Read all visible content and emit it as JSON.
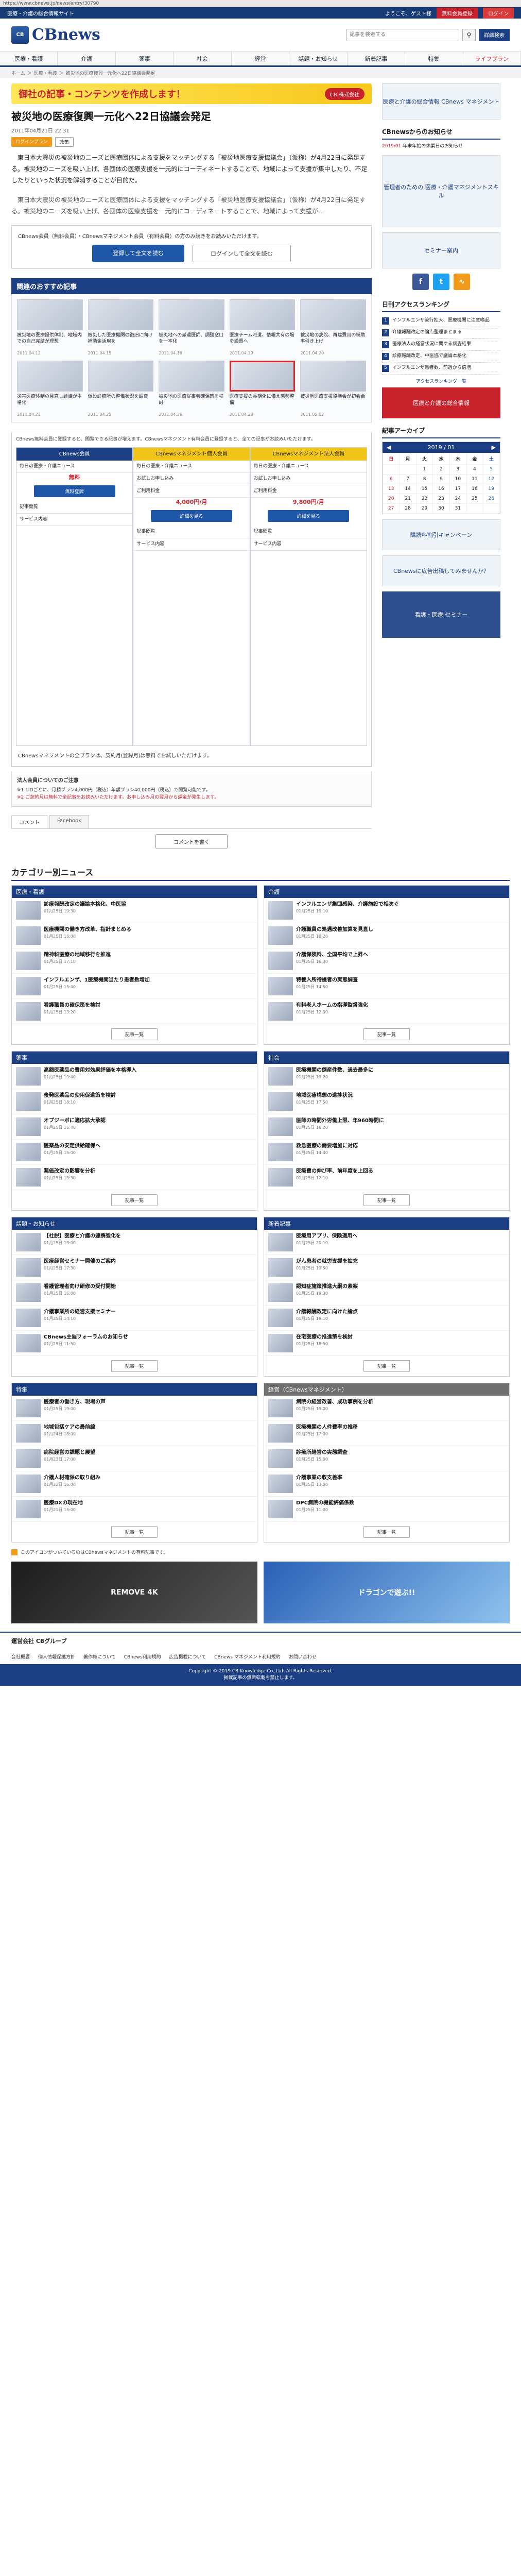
{
  "browser": {
    "url": "https://www.cbnews.jp/news/entry/30790"
  },
  "topstrip": {
    "left": [
      "医療・介護の総合情報サイト"
    ],
    "welcome": "ようこそ、ゲスト様",
    "register": "無料会員登録",
    "login": "ログイン"
  },
  "header": {
    "logo_mark": "CB",
    "logo": "CBnews",
    "search_placeholder": "記事を検索する",
    "advanced": "詳細検索"
  },
  "nav": [
    "医療・看護",
    "介護",
    "薬事",
    "社会",
    "経営",
    "話題・お知らせ",
    "新着記事",
    "特集",
    "ライフプラン"
  ],
  "breadcrumb": [
    "ホーム",
    "＞",
    "医療・看護",
    "＞",
    "被災地の医療復興一元化へ22日協議会発足"
  ],
  "banner": {
    "title": "御社の記事・コンテンツを作成します！",
    "sub": "CB 株式会社"
  },
  "article": {
    "title": "被災地の医療復興一元化へ22日協議会発足",
    "date": "2011年04月21日 22:31",
    "tags": [
      "ログインプラン",
      "政策"
    ],
    "p1": "東日本大震災の被災地のニーズと医療団体による支援をマッチングする「被災地医療支援協議会」（仮称）が4月22日に発足する。被災地のニーズを吸い上げ、各団体の医療支援を一元的にコーディネートすることで、地域によって支援が集中したり、不足したりといった状況を解消することが目的だ。",
    "p2": "東日本大震災の被災地のニーズと医療団体による支援をマッチングする「被災地医療支援協議会」（仮称）が4月22日に発足する。被災地のニーズを吸い上げ、各団体の医療支援を一元的にコーディネートすることで、地域によって支援が..."
  },
  "loginbox": {
    "msg": "CBnews会員（無料会員）・CBnewsマネジメント会員（有料会員）の方のみ続きをお読みいただけます。",
    "register": "登録して全文を読む",
    "login": "ログインして全文を読む"
  },
  "recommend": {
    "heading": "関連のおすすめ記事",
    "items": [
      {
        "t": "被災地の医療提供体制、地域内での自己完結が理想",
        "d": "2011.04.12"
      },
      {
        "t": "被災した医療機関の復旧に向け補助金活用を",
        "d": "2011.04.15"
      },
      {
        "t": "被災地への派遣医師、調整窓口を一本化",
        "d": "2011.04.18"
      },
      {
        "t": "医療チーム派遣、情報共有の場を設置へ",
        "d": "2011.04.19"
      },
      {
        "t": "被災地の病院、再建費用の補助率引き上げ",
        "d": "2011.04.20"
      },
      {
        "t": "災害医療体制の見直し論議が本格化",
        "d": "2011.04.22"
      },
      {
        "t": "仮設診療所の整備状況を調査",
        "d": "2011.04.25"
      },
      {
        "t": "被災地の医療従事者確保策を検討",
        "d": "2011.04.26"
      },
      {
        "t": "医療支援の長期化に備え態勢整備",
        "d": "2011.04.28"
      },
      {
        "t": "被災地医療支援協議会が初会合",
        "d": "2011.05.02"
      }
    ]
  },
  "plans": {
    "note": "CBnews無料会員に登録すると、閲覧できる記事が増えます。CBnewsマネジメント有料会員に登録すると、全ての記事がお読みいただけます。",
    "cols": [
      {
        "name": "CBnews会員",
        "price": "無料",
        "cta": "無料登録"
      },
      {
        "name": "CBnewsマネジメント個人会員",
        "price": "4,000円/月",
        "cta": "詳細を見る"
      },
      {
        "name": "CBnewsマネジメント法人会員",
        "price": "9,800円/月",
        "cta": "詳細を見る"
      }
    ],
    "rows": [
      "毎日の医療・介護ニュース",
      "お試しお申し込み",
      "ご利用料金",
      "記事閲覧",
      "サービス内容"
    ],
    "foot": "CBnewsマネジメントの全プランは、契約月(登録月)は無料でお試しいただけます。"
  },
  "pay": {
    "head": "法人会員についてのご注意",
    "l1": "※1 1IDごとに、月額プラン4,000円（税込）年額プラン40,000円（税込）で閲覧可能です。",
    "l2": "※2 ご契約月は無料で全記事をお読みいただけます。お申し込み月の翌月から課金が発生します。"
  },
  "comments": {
    "tab1": "コメント",
    "tab2": "Facebook",
    "btn": "コメントを書く"
  },
  "side": {
    "ad1": "医療と介護の総合情報 CBnews マネジメント",
    "news_h": "CBnewsからのお知らせ",
    "news": [
      {
        "d": "2019/01",
        "t": "年末年始の休業日のお知らせ"
      }
    ],
    "ad2": "管理者のための 医療・介護マネジメントスキル",
    "ad3": "セミナー案内",
    "rank_h": "日刊アクセスランキング",
    "rank": [
      "インフルエンザ流行拡大、医療機関に注意喚起",
      "介護報酬改定の論点整理まとまる",
      "医療法人の経営状況に関する調査結果",
      "診療報酬改定、中医協で議論本格化",
      "インフルエンザ患者数、前週から倍増"
    ],
    "more": "アクセスランキング一覧",
    "ad4": "医療と介護の総合情報",
    "archive_h": "記事アーカイブ",
    "cal_title": "2019 / 01",
    "cal_days": [
      "日",
      "月",
      "火",
      "水",
      "木",
      "金",
      "土"
    ],
    "ad5": "購読料割引キャンペーン",
    "ad6": "CBnewsに広告出稿してみませんか？",
    "ad7": "看護・医療 セミナー"
  },
  "categories": {
    "heading": "カテゴリー別ニュース",
    "boxes": [
      {
        "name": "医療・看護",
        "items": [
          {
            "t": "診療報酬改定の議論本格化、中医協",
            "d": "01月25日 19:30"
          },
          {
            "t": "医療機関の働き方改革、指針まとめる",
            "d": "01月25日 18:00"
          },
          {
            "t": "精神科医療の地域移行を推進",
            "d": "01月25日 17:10"
          },
          {
            "t": "インフルエンザ、1医療機関当たり患者数増加",
            "d": "01月25日 15:40"
          },
          {
            "t": "看護職員の確保策を検討",
            "d": "01月25日 13:20"
          }
        ]
      },
      {
        "name": "介護",
        "items": [
          {
            "t": "インフルエンザ集団感染、介護施設で相次ぐ",
            "d": "01月25日 19:10"
          },
          {
            "t": "介護職員の処遇改善加算を見直し",
            "d": "01月25日 18:20"
          },
          {
            "t": "介護保険料、全国平均で上昇へ",
            "d": "01月25日 16:30"
          },
          {
            "t": "特養入所待機者の実態調査",
            "d": "01月25日 14:50"
          },
          {
            "t": "有料老人ホームの指導監督強化",
            "d": "01月25日 12:00"
          }
        ]
      },
      {
        "name": "薬事",
        "items": [
          {
            "t": "高額医薬品の費用対効果評価を本格導入",
            "d": "01月25日 19:40"
          },
          {
            "t": "後発医薬品の使用促進策を検討",
            "d": "01月25日 18:10"
          },
          {
            "t": "オプジーボに適応拡大承認",
            "d": "01月25日 16:40"
          },
          {
            "t": "医薬品の安定供給確保へ",
            "d": "01月25日 15:00"
          },
          {
            "t": "薬価改定の影響を分析",
            "d": "01月25日 13:30"
          }
        ]
      },
      {
        "name": "社会",
        "items": [
          {
            "t": "医療機関の倒産件数、過去最多に",
            "d": "01月25日 19:20"
          },
          {
            "t": "地域医療構想の進捗状況",
            "d": "01月25日 17:50"
          },
          {
            "t": "医師の時間外労働上限、年960時間に",
            "d": "01月25日 16:20"
          },
          {
            "t": "救急医療の需要増加に対応",
            "d": "01月25日 14:40"
          },
          {
            "t": "医療費の伸び率、前年度を上回る",
            "d": "01月25日 12:10"
          }
        ]
      },
      {
        "name": "話題・お知らせ",
        "items": [
          {
            "t": "【社説】医療と介護の連携強化を",
            "d": "01月25日 19:00"
          },
          {
            "t": "医療経営セミナー開催のご案内",
            "d": "01月25日 17:30"
          },
          {
            "t": "看護管理者向け研修の受付開始",
            "d": "01月25日 16:00"
          },
          {
            "t": "介護事業所の経営支援セミナー",
            "d": "01月25日 14:10"
          },
          {
            "t": "CBnews主催フォーラムのお知らせ",
            "d": "01月25日 11:50"
          }
        ]
      },
      {
        "name": "新着記事",
        "items": [
          {
            "t": "医療用アプリ、保険適用へ",
            "d": "01月25日 20:10"
          },
          {
            "t": "がん患者の就労支援を拡充",
            "d": "01月25日 19:50"
          },
          {
            "t": "認知症施策推進大綱の素案",
            "d": "01月25日 19:30"
          },
          {
            "t": "介護報酬改定に向けた論点",
            "d": "01月25日 19:10"
          },
          {
            "t": "在宅医療の推進策を検討",
            "d": "01月25日 18:50"
          }
        ]
      },
      {
        "name": "特集",
        "items": [
          {
            "t": "医療者の働き方、現場の声",
            "d": "01月25日 19:00"
          },
          {
            "t": "地域包括ケアの最前線",
            "d": "01月24日 18:00"
          },
          {
            "t": "病院経営の課題と展望",
            "d": "01月23日 17:00"
          },
          {
            "t": "介護人材確保の取り組み",
            "d": "01月22日 16:00"
          },
          {
            "t": "医療DXの現在地",
            "d": "01月21日 15:00"
          }
        ]
      },
      {
        "name": "経営（CBnewsマネジメント）",
        "items": [
          {
            "t": "病院の経営改善、成功事例を分析",
            "d": "01月25日 19:00"
          },
          {
            "t": "医療機関の人件費率の推移",
            "d": "01月25日 17:00"
          },
          {
            "t": "診療所経営の実態調査",
            "d": "01月25日 15:00"
          },
          {
            "t": "介護事業の収支差率",
            "d": "01月25日 13:00"
          },
          {
            "t": "DPC病院の機能評価係数",
            "d": "01月25日 11:00"
          }
        ]
      }
    ],
    "more": "記事一覧"
  },
  "legend": "このアイコンがついているのはCBnewsマネジメントの有料記事です。",
  "bottom_ads": [
    "REMOVE 4K",
    "ドラゴンで遊ぶ!!"
  ],
  "footer": {
    "brand": "運営会社 CBグループ",
    "links": [
      "会社概要",
      "個人情報保護方針",
      "著作権について",
      "CBnews利用規約",
      "広告掲載について",
      "CBnews マネジメント利用規約",
      "お問い合わせ"
    ],
    "copy": "Copyright © 2019 CB Knowledge Co.,Ltd. All Rights Reserved.",
    "copy2": "掲載記事の無断転載を禁止します。"
  }
}
